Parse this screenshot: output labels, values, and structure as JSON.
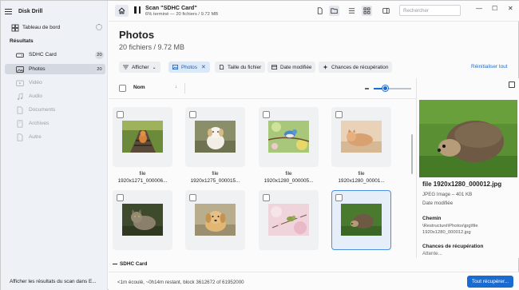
{
  "app": {
    "title": "Disk Drill"
  },
  "sidebar": {
    "dashboard_label": "Tableau de bord",
    "results_heading": "Résultats",
    "items": [
      {
        "label": "SDHC Card",
        "count": "20",
        "icon": "drive-icon",
        "state": "normal"
      },
      {
        "label": "Photos",
        "count": "20",
        "icon": "image-icon",
        "state": "active"
      },
      {
        "label": "Vidéo",
        "icon": "video-icon",
        "state": "disabled"
      },
      {
        "label": "Audio",
        "icon": "music-icon",
        "state": "disabled"
      },
      {
        "label": "Documents",
        "icon": "document-icon",
        "state": "disabled"
      },
      {
        "label": "Archives",
        "icon": "archive-icon",
        "state": "disabled"
      },
      {
        "label": "Autre",
        "icon": "file-icon",
        "state": "disabled"
      }
    ],
    "footer_label": "Afficher les résultats du scan dans E..."
  },
  "topbar": {
    "scan_title": "Scan \"SDHC Card\"",
    "scan_subtitle": "6% terminé — 20 fichiers / 9.72 MB",
    "search_placeholder": "Rechercher"
  },
  "header": {
    "title": "Photos",
    "subtitle": "20 fichiers / 9.72 MB"
  },
  "filters": {
    "show_label": "Afficher",
    "photos_label": "Photos",
    "size_label": "Taille du fichier",
    "date_label": "Date modifiée",
    "chances_label": "Chances de récupération",
    "reset_label": "Réinitialiser tout"
  },
  "columns": {
    "name_label": "Nom"
  },
  "zoom_level": 0.25,
  "files": [
    {
      "cap1": "file",
      "cap2": "1920x1271_000006..."
    },
    {
      "cap1": "file",
      "cap2": "1920x1275_000015..."
    },
    {
      "cap1": "file",
      "cap2": "1920x1280_000005..."
    },
    {
      "cap1": "file",
      "cap2": "1920x1280_00001..."
    },
    {
      "cap1": "",
      "cap2": ""
    },
    {
      "cap1": "",
      "cap2": ""
    },
    {
      "cap1": "",
      "cap2": ""
    },
    {
      "cap1": "",
      "cap2": ""
    }
  ],
  "drive_label": "SDHC Card",
  "preview": {
    "filename": "file 1920x1280_000012.jpg",
    "type_size": "JPEG Image – 401 KB",
    "date_label": "Date modifiée",
    "path_heading": "Chemin",
    "path_value": "\\Restructuré\\Photos\\jpg\\file 1920x1280_000012.jpg",
    "chances_heading": "Chances de récupération",
    "chances_value": "Attente..."
  },
  "statusbar": {
    "text": "<1m écoulé, ~0h14m restant, block 3612672 of 61952000",
    "recover_label": "Tout récupérer..."
  },
  "colors": {
    "accent": "#1a6bd1"
  }
}
